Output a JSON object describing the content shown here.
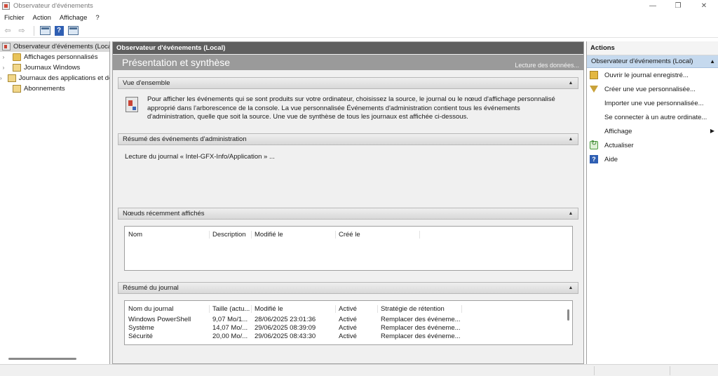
{
  "window": {
    "title": "Observateur d'événements",
    "controls": {
      "minimize": "—",
      "maximize": "❐",
      "close": "✕"
    }
  },
  "menu": [
    "Fichier",
    "Action",
    "Affichage",
    "?"
  ],
  "toolbar": {
    "back": "⇦",
    "forward": "⇨",
    "help": "?"
  },
  "tree": {
    "items": [
      {
        "label": "Observateur d'événements (Local)",
        "expander": "",
        "selected": true,
        "icon": "event-viewer-icon"
      },
      {
        "label": "Affichages personnalisés",
        "expander": "›",
        "icon": "custom-views-folder-icon"
      },
      {
        "label": "Journaux Windows",
        "expander": "›",
        "icon": "windows-logs-icon"
      },
      {
        "label": "Journaux des applications et de services",
        "expander": "›",
        "icon": "app-logs-icon"
      },
      {
        "label": "Abonnements",
        "expander": "",
        "icon": "subscriptions-icon"
      }
    ]
  },
  "center": {
    "header": "Observateur d'événements (Local)",
    "banner_title": "Présentation et synthèse",
    "banner_link": "Lecture des données...",
    "collapse_glyph": "▲",
    "overview": {
      "title": "Vue d'ensemble",
      "text": "Pour afficher les événements qui se sont produits sur votre ordinateur, choisissez la source, le journal ou le nœud d'affichage personnalisé approprié dans l'arborescence de la console. La vue personnalisée Événements d'administration contient tous les événements d'administration, quelle que soit la source. Une vue de synthèse de tous les journaux est affichée ci-dessous."
    },
    "admin_summary": {
      "title": "Résumé des événements d'administration",
      "text": "Lecture du journal « Intel-GFX-Info/Application » ..."
    },
    "recent_nodes": {
      "title": "Nœuds récemment affichés",
      "columns": [
        "Nom",
        "Description",
        "Modifié le",
        "Créé le"
      ]
    },
    "log_summary": {
      "title": "Résumé du journal",
      "columns": [
        "Nom du journal",
        "Taille (actu...",
        "Modifié le",
        "Activé",
        "Stratégie de rétention"
      ],
      "rows": [
        [
          "Windows PowerShell",
          "9,07 Mo/1...",
          "28/06/2025 23:01:36",
          "Activé",
          "Remplacer des événeme..."
        ],
        [
          "Système",
          "14,07 Mo/...",
          "29/06/2025 08:39:09",
          "Activé",
          "Remplacer des événeme..."
        ],
        [
          "Sécurité",
          "20,00 Mo/...",
          "29/06/2025 08:43:30",
          "Activé",
          "Remplacer des événeme..."
        ]
      ]
    }
  },
  "actions": {
    "title": "Actions",
    "group": "Observateur d'événements (Local)",
    "group_caret": "▲",
    "submenu_glyph": "▶",
    "items": [
      {
        "label": "Ouvrir le journal enregistré...",
        "icon": "open-folder-icon"
      },
      {
        "label": "Créer une vue personnalisée...",
        "icon": "filter-icon"
      },
      {
        "label": "Importer une vue personnalisée...",
        "icon": ""
      },
      {
        "label": "Se connecter à un autre ordinate...",
        "icon": ""
      },
      {
        "label": "Affichage",
        "icon": "",
        "submenu": true
      },
      {
        "label": "Actualiser",
        "icon": "refresh-icon"
      },
      {
        "label": "Aide",
        "icon": "help-icon"
      }
    ]
  }
}
